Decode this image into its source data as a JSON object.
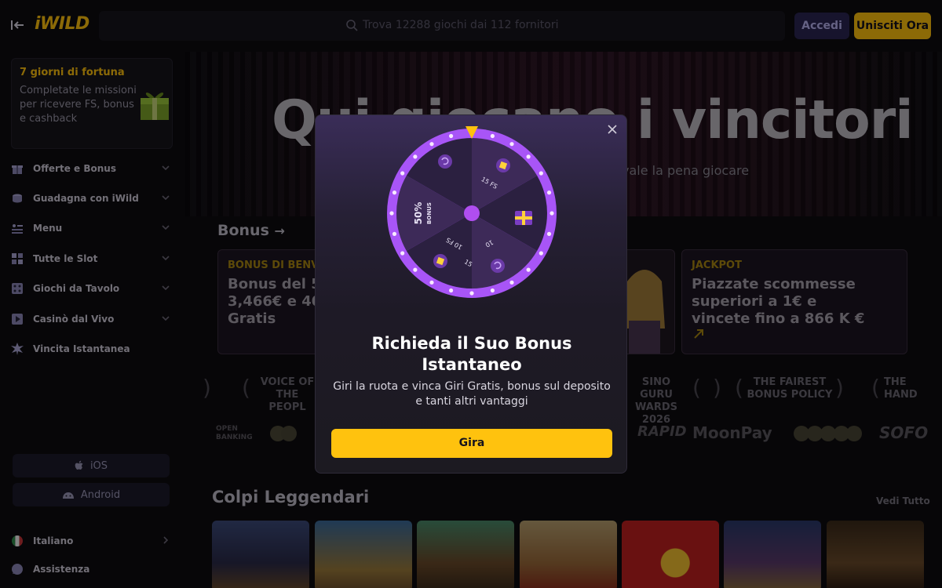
{
  "header": {
    "logo": "iWILD",
    "search_placeholder": "Trova 12288 giochi dai 112 fornitori",
    "login_label": "Accedi",
    "join_label": "Unisciti Ora"
  },
  "sidebar": {
    "promo": {
      "title": "7 giorni di fortuna",
      "description": "Completate le missioni per ricevere FS, bonus e cashback"
    },
    "items": [
      {
        "label": "Offerte e Bonus",
        "icon": "gift-icon"
      },
      {
        "label": "Guadagna con iWild",
        "icon": "coins-icon"
      },
      {
        "label": "Menu",
        "icon": "menu-icon"
      },
      {
        "label": "Tutte le Slot",
        "icon": "grid-icon"
      },
      {
        "label": "Giochi da Tavolo",
        "icon": "dice-icon"
      },
      {
        "label": "Casinò dal Vivo",
        "icon": "live-icon"
      },
      {
        "label": "Vincita Istantanea",
        "icon": "burst-icon"
      }
    ],
    "ios_label": "iOS",
    "android_label": "Android",
    "language_label": "Italiano",
    "support_label": "Assistenza"
  },
  "hero": {
    "title": "Qui giocano i vincitori",
    "subtitle": "vale la pena giocare"
  },
  "bonus_section": {
    "title": "Bonus",
    "cards": [
      {
        "tag": "BONUS DI BENVE",
        "line1": "Bonus del 5",
        "line2": "3,466€ e 40",
        "line3": "Gratis"
      },
      {
        "tag": "JACKPOT",
        "line1": "Piazzate scommesse",
        "line2": "superiori a 1€ e",
        "line3": "vincete fino a 866 K €"
      }
    ]
  },
  "awards": [
    {
      "line1": "VOICE OF",
      "line2": "THE PEOPL"
    },
    {
      "line1": "SINO GURU",
      "line2": "WARDS 2026"
    },
    {
      "line1": "THE FAIREST",
      "line2": "BONUS POLICY"
    },
    {
      "line1": "THE",
      "line2": "HAND"
    }
  ],
  "payments": {
    "open_banking_1": "OPEN",
    "open_banking_2": "BANKING",
    "rapid": "RAPID",
    "moonpay": "MoonPay",
    "sofort": "SOFO"
  },
  "legendary": {
    "title": "Colpi Leggendari",
    "see_all": "Vedi Tutto"
  },
  "modal": {
    "title_line1": "Richieda il Suo Bonus",
    "title_line2": "Istantaneo",
    "description": "Giri la ruota e vinca Giri Gratis, bonus sul deposito e tanti altri vantaggi",
    "spin_label": "Gira",
    "wheel": {
      "seg_15fs": "15 FS",
      "seg_15": "15",
      "seg_10fs": "10 FS",
      "seg_10": "10",
      "seg_50_big": "50%",
      "seg_50_small": "BONUS"
    }
  },
  "colors": {
    "accent": "#ffc20e",
    "wheel_rim": "#a855f7",
    "background": "#0d0c10"
  }
}
